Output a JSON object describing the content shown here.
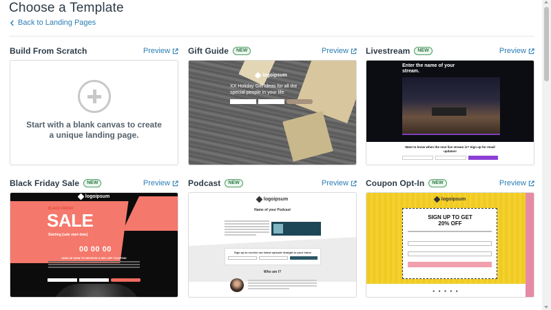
{
  "page": {
    "title": "Choose a Template",
    "back_link": "Back to Landing Pages"
  },
  "templates": [
    {
      "name": "Build From Scratch",
      "badge": "",
      "preview_label": "Preview",
      "thumb_text": "Start with a blank canvas to create a unique landing page."
    },
    {
      "name": "Gift Guide",
      "badge": "NEW",
      "preview_label": "Preview"
    },
    {
      "name": "Livestream",
      "badge": "NEW",
      "preview_label": "Preview"
    },
    {
      "name": "Black Friday Sale",
      "badge": "NEW",
      "preview_label": "Preview"
    },
    {
      "name": "Podcast",
      "badge": "NEW",
      "preview_label": "Preview"
    },
    {
      "name": "Coupon Opt-In",
      "badge": "NEW",
      "preview_label": "Preview"
    }
  ],
  "thumbs": {
    "logo_text": "logoipsum",
    "gift": {
      "heading": "XX Holiday Gift Ideas for all the special people in your life"
    },
    "livestream": {
      "heading": "Enter the name of your stream.",
      "question": "Want to know when the next live stream is? Sign up for email updates!"
    },
    "black_friday": {
      "eyebrow": "BLACK FRIDAY",
      "sale": "SALE",
      "starting": "Starting [sale start date]",
      "countdown": "00 00 00",
      "signup": "SIGN UP NOW TO RECEIVE A 50% OFF COUPON!"
    },
    "podcast": {
      "title": "Name of your Podcast",
      "form_question": "Sign up to receive our latest episode straight to your inbox",
      "who": "Who am I?"
    },
    "coupon": {
      "heading_line1": "SIGN UP TO GET",
      "heading_line2": "20% OFF"
    }
  }
}
